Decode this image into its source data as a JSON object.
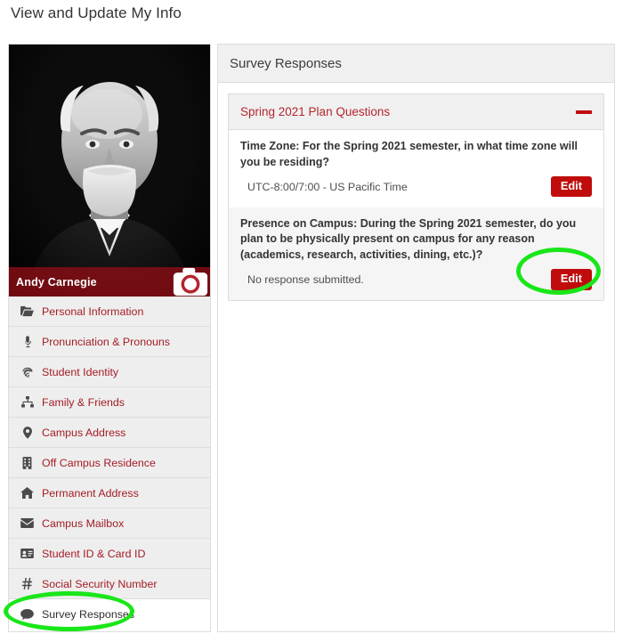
{
  "page": {
    "title": "View and Update My Info"
  },
  "profile": {
    "name": "Andy Carnegie",
    "photo_alt": "portrait-photo",
    "camera_icon": "camera-icon"
  },
  "sidebar": {
    "items": [
      {
        "label": "Personal Information",
        "icon": "folder-open-icon",
        "active": false
      },
      {
        "label": "Pronunciation & Pronouns",
        "icon": "microphone-icon",
        "active": false
      },
      {
        "label": "Student Identity",
        "icon": "fingerprint-icon",
        "active": false
      },
      {
        "label": "Family & Friends",
        "icon": "sitemap-icon",
        "active": false
      },
      {
        "label": "Campus Address",
        "icon": "map-marker-icon",
        "active": false
      },
      {
        "label": "Off Campus Residence",
        "icon": "building-icon",
        "active": false
      },
      {
        "label": "Permanent Address",
        "icon": "home-icon",
        "active": false
      },
      {
        "label": "Campus Mailbox",
        "icon": "envelope-icon",
        "active": false
      },
      {
        "label": "Student ID & Card ID",
        "icon": "id-card-icon",
        "active": false
      },
      {
        "label": "Social Security Number",
        "icon": "hashtag-icon",
        "active": false
      },
      {
        "label": "Survey Responses",
        "icon": "comment-icon",
        "active": true
      }
    ]
  },
  "panel": {
    "title": "Survey Responses",
    "card": {
      "title": "Spring 2021 Plan Questions",
      "collapse_icon": "minus-icon",
      "questions": [
        {
          "question": "Time Zone: For the Spring 2021 semester, in what time zone will you be residing?",
          "answer": "UTC-8:00/7:00 - US Pacific Time",
          "edit_label": "Edit",
          "striped": false
        },
        {
          "question": "Presence on Campus: During the Spring 2021 semester, do you plan to be physically present on campus for any reason (academics, research, activities, dining, etc.)?",
          "answer": "No response submitted.",
          "edit_label": "Edit",
          "striped": true
        }
      ]
    }
  },
  "colors": {
    "brand_red": "#c00c0c",
    "link_red": "#a41d26",
    "name_bar": "#8c0e16",
    "annotation_green": "#19e619",
    "panel_gray": "#f0f0f0",
    "stripe_gray": "#f5f5f5",
    "border_gray": "#dddddd"
  }
}
